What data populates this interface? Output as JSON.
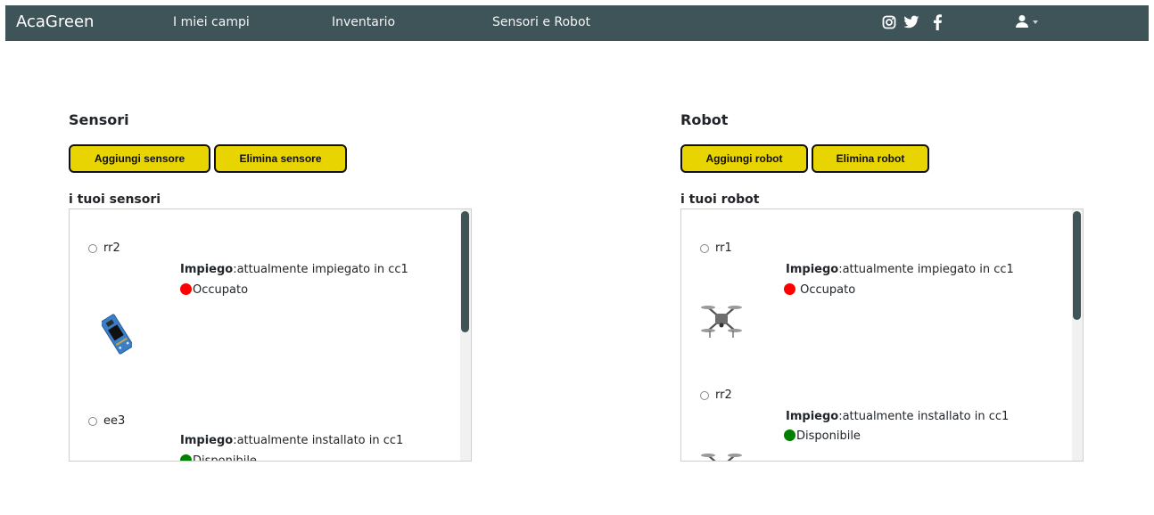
{
  "navbar": {
    "brand": "AcaGreen",
    "links": [
      "I miei campi",
      "Inventario",
      "Sensori e Robot"
    ],
    "social_icons": [
      "instagram-icon",
      "twitter-icon",
      "facebook-icon"
    ],
    "user_icon": "user-icon",
    "background": "#3e5459"
  },
  "sensors": {
    "title": "Sensori",
    "add_label": "Aggiungi sensore",
    "delete_label": "Elimina sensore",
    "list_label": "i tuoi sensori",
    "items": [
      {
        "name": "rr2",
        "usage_key": "Impiego",
        "usage_text": ":attualmente impiegato in cc1",
        "status": "Occupato",
        "status_color": "#ff0000",
        "image": "sensor-module-image"
      },
      {
        "name": "ee3",
        "usage_key": "Impiego",
        "usage_text": ":attualmente installato in cc1",
        "status": "Disponibile",
        "status_color": "#008000",
        "image": "sensor-module-image"
      }
    ]
  },
  "robots": {
    "title": "Robot",
    "add_label": "Aggiungi robot",
    "delete_label": "Elimina robot",
    "list_label": "i tuoi robot",
    "items": [
      {
        "name": "rr1",
        "usage_key": "Impiego",
        "usage_text": ":attualmente impiegato in cc1",
        "status": " Occupato",
        "status_color": "#ff0000",
        "image": "drone-image"
      },
      {
        "name": "rr2",
        "usage_key": "Impiego",
        "usage_text": ":attualmente installato in cc1",
        "status": "Disponibile",
        "status_color": "#008000",
        "image": "drone-image"
      }
    ]
  },
  "colors": {
    "accent_button": "#e8d400",
    "busy": "#ff0000",
    "available": "#008000"
  }
}
